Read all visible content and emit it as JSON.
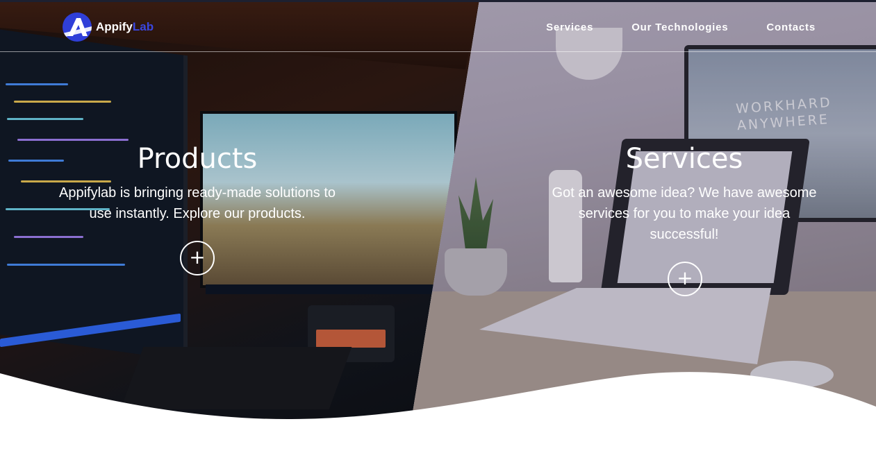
{
  "header": {
    "logo_primary": "Appify",
    "logo_accent": "Lab",
    "nav": [
      {
        "label": "Services"
      },
      {
        "label": "Our Technologies"
      },
      {
        "label": "Contacts"
      }
    ]
  },
  "hero": {
    "products": {
      "title": "Products",
      "description": "Appifylab is bringing ready-made solutions to use instantly. Explore our products.",
      "button_icon": "plus-icon",
      "button_glyph": "+"
    },
    "services": {
      "title": "Services",
      "description": "Got an awesome idea? We have awesome services for you to make your idea successful!",
      "button_icon": "plus-icon",
      "button_glyph": "+"
    },
    "monitor_text": "WORKHARD ANYWHERE"
  },
  "colors": {
    "brand": "#2f3fd8",
    "accent": "#3a47e0",
    "topbar": "#1d2030",
    "text": "#ffffff"
  }
}
